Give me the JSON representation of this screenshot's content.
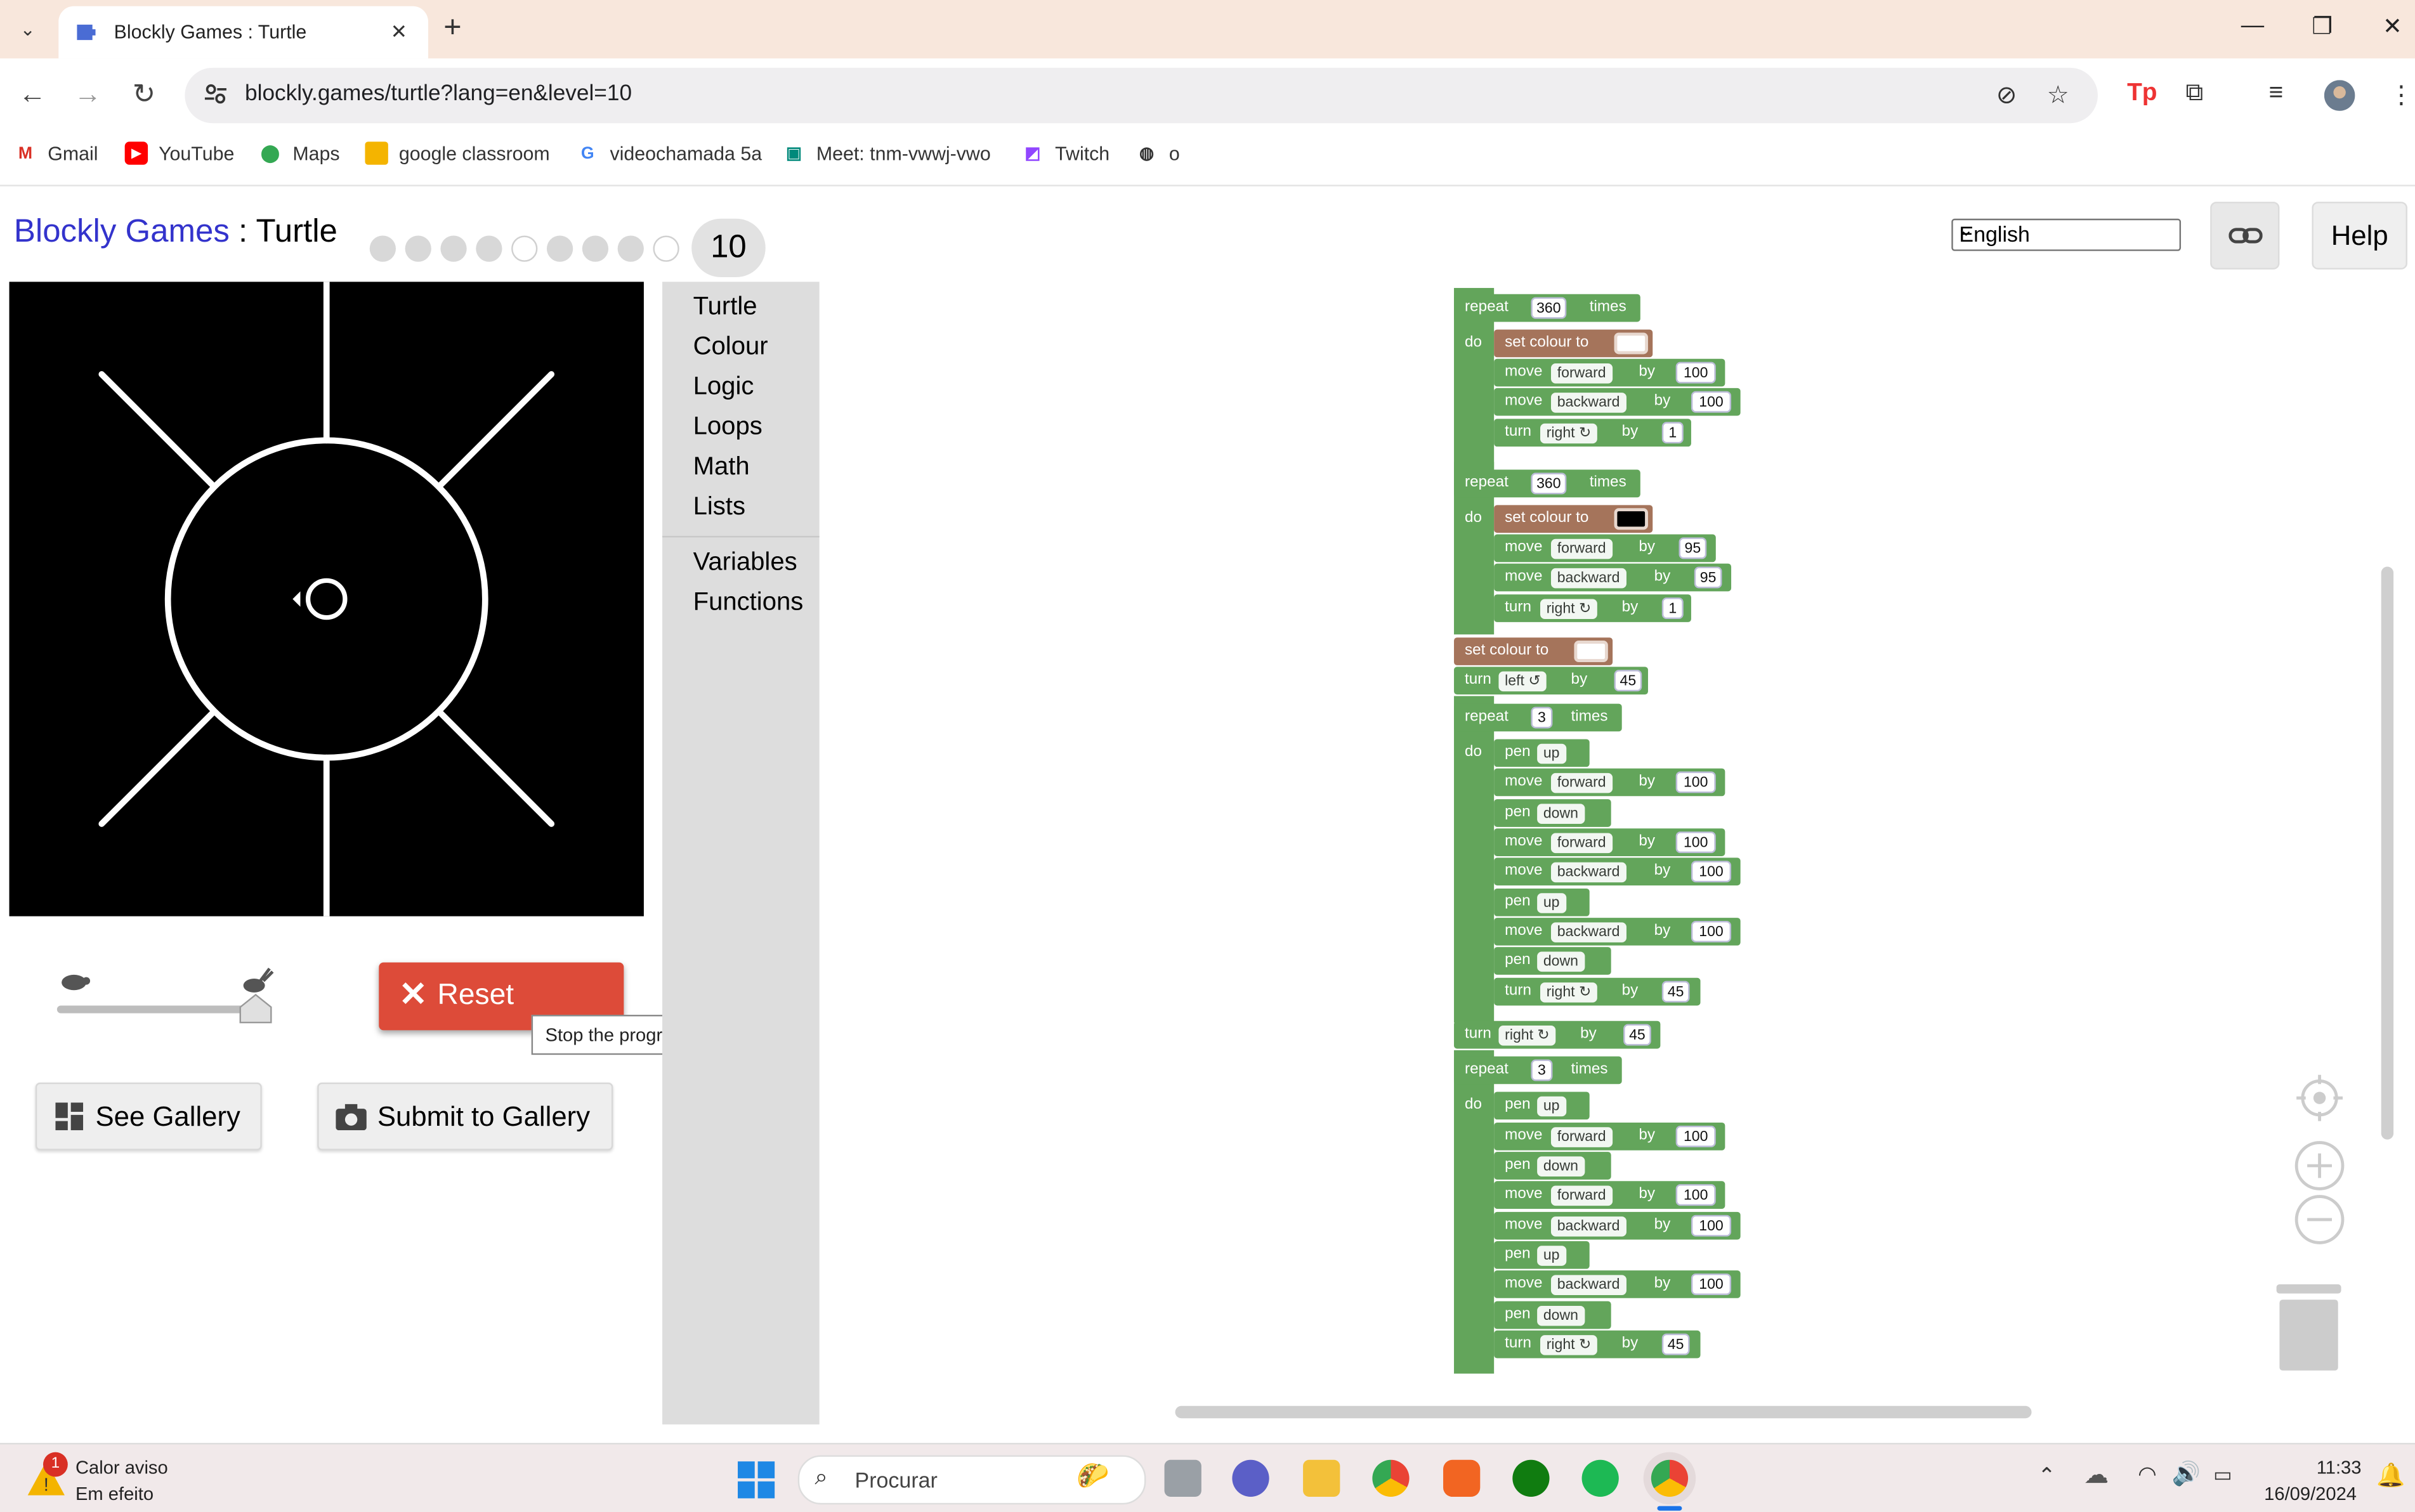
{
  "browser": {
    "tab_title": "Blockly Games : Turtle",
    "url": "blockly.games/turtle?lang=en&level=10",
    "bookmarks": [
      "Gmail",
      "YouTube",
      "Maps",
      "google classroom",
      "videochamada 5a",
      "Meet: tnm-vwwj-vwo",
      "Twitch",
      "o"
    ]
  },
  "header": {
    "brand": "Blockly Games",
    "separator": " : ",
    "game": "Turtle",
    "current_level": "10",
    "language": "English",
    "help_label": "Help"
  },
  "controls": {
    "reset_label": "Reset",
    "reset_tooltip": "Stop the program and reset the level.",
    "see_gallery_label": "See Gallery",
    "submit_gallery_label": "Submit to Gallery"
  },
  "categories": [
    "Turtle",
    "Colour",
    "Logic",
    "Loops",
    "Math",
    "Lists",
    "Variables",
    "Functions"
  ],
  "blocks": {
    "repeat": "repeat",
    "times": "times",
    "do": "do",
    "set_colour": "set colour to",
    "move": "move",
    "turn": "turn",
    "pen": "pen",
    "by": "by",
    "forward": "forward",
    "backward": "backward",
    "right": "right ↻",
    "left": "left ↺",
    "up": "up",
    "down": "down",
    "n360": "360",
    "n100": "100",
    "n95": "95",
    "n1": "1",
    "n45": "45",
    "n3": "3"
  },
  "taskbar": {
    "weather_title": "Calor aviso",
    "weather_sub": "Em efeito",
    "weather_badge": "1",
    "search_placeholder": "Procurar",
    "time": "11:33",
    "date": "16/09/2024"
  },
  "colors": {
    "loop_block": "#63a55b",
    "colour_block": "#a5745b",
    "reset_button": "#dd4b39",
    "brand_link": "#3333cc"
  }
}
